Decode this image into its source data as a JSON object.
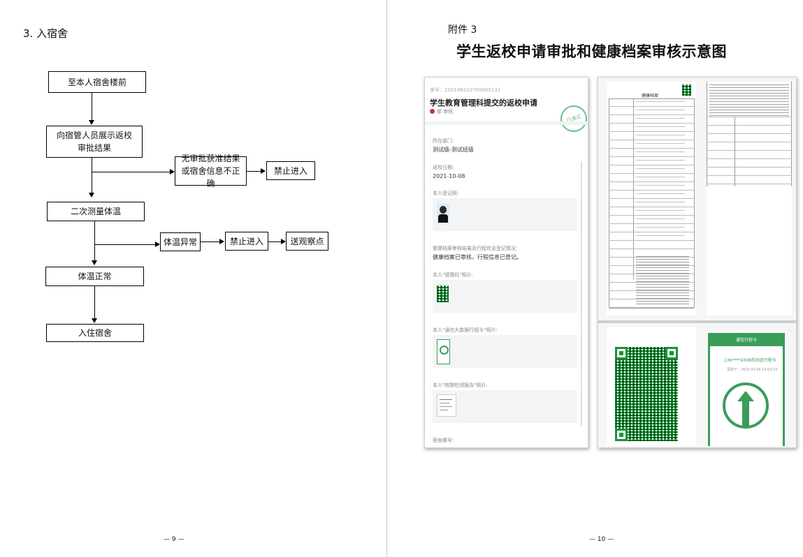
{
  "left_page": {
    "section_title": "3. 入宿舍",
    "page_number": "— 9 —",
    "flow": {
      "step1": "至本人宿舍楼前",
      "step2": "向宿管人员展示返校审批结果",
      "branch_fail": "无审批获准结果或宿舍信息不正确",
      "deny1": "禁止进入",
      "step3": "二次测量体温",
      "temp_abnormal": "体温异常",
      "deny2": "禁止进入",
      "observe": "送观察点",
      "temp_normal": "体温正常",
      "step_final": "入住宿舍"
    }
  },
  "right_page": {
    "appendix": "附件 3",
    "title": "学生返校申请审批和健康档案审核示意图",
    "page_number": "— 10 —",
    "screenshot1": {
      "serial": "单号：202106210700080131",
      "heading": "学生教育管理科提交的返校申请",
      "status": "已通过",
      "tag": "部 审核",
      "dept_label": "所在部门:",
      "dept_value": "测试级-测试班级",
      "date_label": "返校日期:",
      "date_value": "2021-10-08",
      "photo_label": "本人登记照:",
      "health_label": "健康档案审核结果及行程信息登记情况:",
      "health_value": "健康档案已审核，行程信息已登记。",
      "code_label": "本人\"健康码\"照片:",
      "trip_label": "本人\"通信大数据行程卡\"照片:",
      "test_label": "本人\"核酸检测报告\"照片:",
      "dorm_label": "宿舍楼号:"
    },
    "screenshot2": {
      "heading": "健康档案",
      "trip_card_header": "通信行程卡",
      "trip_phone": "136****4308的动态行程卡",
      "trip_update": "更新于：2020.04.06 14:02:02"
    }
  }
}
